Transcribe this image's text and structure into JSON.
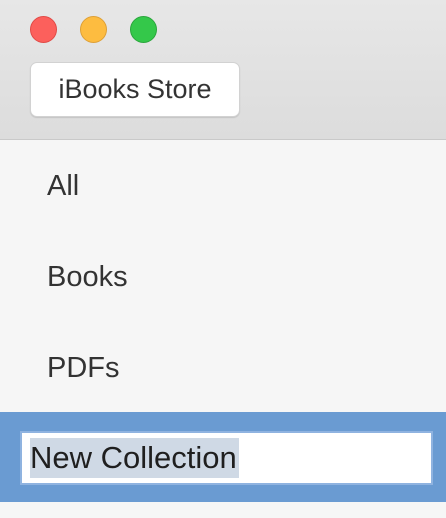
{
  "window": {
    "controls": {
      "close": "close-button",
      "minimize": "minimize-button",
      "zoom": "zoom-button"
    }
  },
  "toolbar": {
    "store_button_label": "iBooks Store"
  },
  "sidebar": {
    "items": [
      {
        "label": "All"
      },
      {
        "label": "Books"
      },
      {
        "label": "PDFs"
      }
    ],
    "editing_item": {
      "value": "New Collection"
    }
  },
  "colors": {
    "selection": "#6a9bd2",
    "close": "#fc605c",
    "minimize": "#fdbc40",
    "zoom": "#34c84a"
  }
}
